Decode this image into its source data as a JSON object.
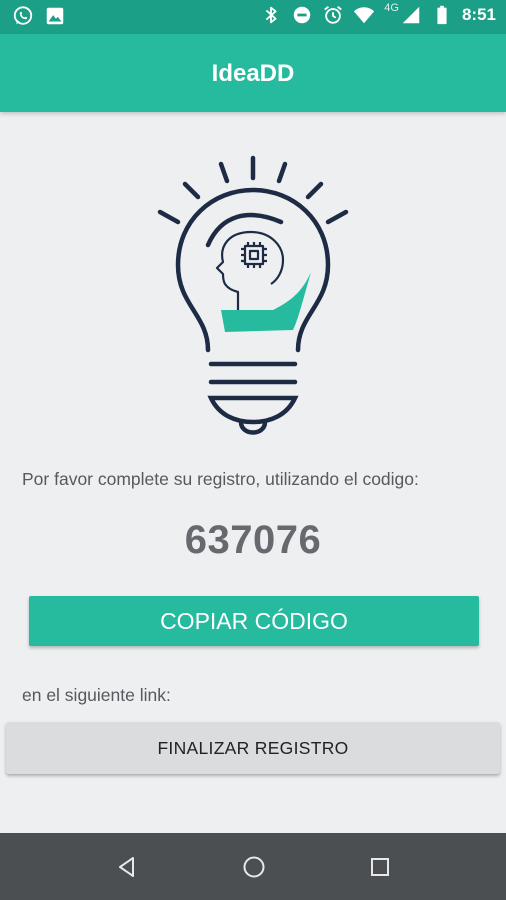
{
  "status_bar": {
    "network_type": "4G",
    "time": "8:51",
    "icons": [
      "whatsapp-icon",
      "image-icon",
      "bluetooth-icon",
      "do-not-disturb-icon",
      "alarm-icon",
      "wifi-icon",
      "signal-icon",
      "battery-icon"
    ]
  },
  "app_bar": {
    "title": "IdeaDD"
  },
  "colors": {
    "primary": "#26bb9e",
    "primary_dark": "#1b9f86",
    "outline": "#1e2b45",
    "background": "#eeeff1",
    "nav_bar": "#4b4f52"
  },
  "main": {
    "illustration": "lightbulb-head-icon",
    "instruction": "Por favor complete su registro, utilizando el codigo:",
    "code": "637076",
    "copy_button": "COPIAR CÓDIGO",
    "link_label": "en el siguiente link:",
    "finalize_button": "FINALIZAR REGISTRO"
  },
  "nav_bar": {
    "buttons": [
      "back-icon",
      "home-icon",
      "recents-icon"
    ]
  }
}
